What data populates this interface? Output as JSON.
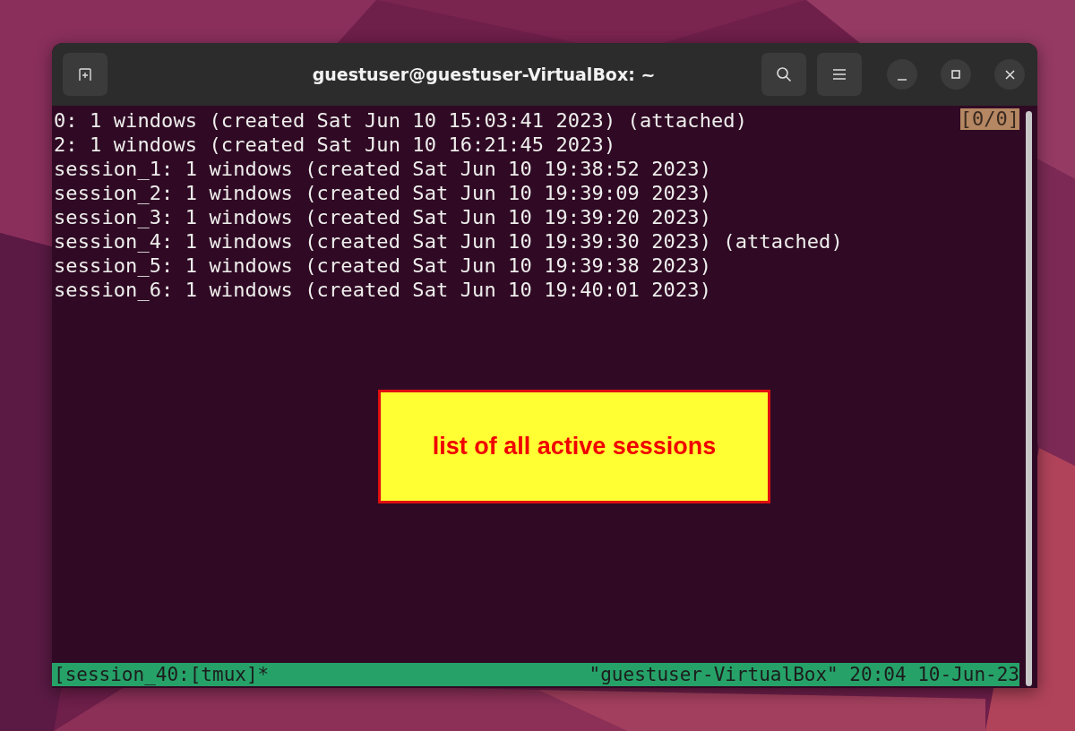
{
  "window": {
    "title": "guestuser@guestuser-VirtualBox: ~"
  },
  "terminal": {
    "lines": [
      "0: 1 windows (created Sat Jun 10 15:03:41 2023) (attached)",
      "2: 1 windows (created Sat Jun 10 16:21:45 2023)",
      "session_1: 1 windows (created Sat Jun 10 19:38:52 2023)",
      "session_2: 1 windows (created Sat Jun 10 19:39:09 2023)",
      "session_3: 1 windows (created Sat Jun 10 19:39:20 2023)",
      "session_4: 1 windows (created Sat Jun 10 19:39:30 2023) (attached)",
      "session_5: 1 windows (created Sat Jun 10 19:39:38 2023)",
      "session_6: 1 windows (created Sat Jun 10 19:40:01 2023)"
    ],
    "position_indicator": "[0/0]"
  },
  "status_bar": {
    "left": "[session_40:[tmux]*",
    "right": "\"guestuser-VirtualBox\" 20:04 10-Jun-23"
  },
  "annotation": {
    "text": "list of all active sessions"
  }
}
